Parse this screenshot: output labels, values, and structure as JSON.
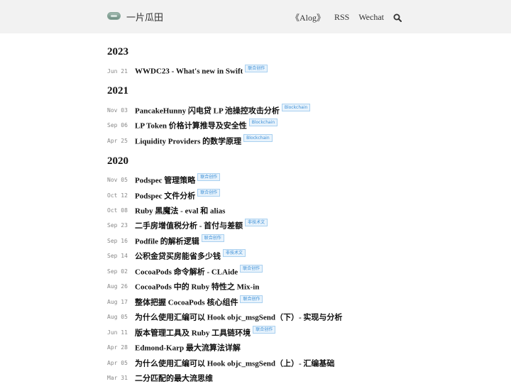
{
  "header": {
    "site_title": "一片瓜田",
    "nav": [
      "《Alog》",
      "RSS",
      "Wechat"
    ],
    "search_icon": "search-icon"
  },
  "archive": [
    {
      "year": "2023",
      "posts": [
        {
          "date": "Jun 21",
          "title": "WWDC23 - What's new in Swift",
          "tag": "联合创作"
        }
      ]
    },
    {
      "year": "2021",
      "posts": [
        {
          "date": "Nov 03",
          "title": "PancakeHunny 闪电贷 LP 池操控攻击分析",
          "tag": "Blockchain"
        },
        {
          "date": "Sep 06",
          "title": "LP Token 价格计算推导及安全性",
          "tag": "Blockchain"
        },
        {
          "date": "Apr 25",
          "title": "Liquidity Providers 的数学原理",
          "tag": "Blockchain"
        }
      ]
    },
    {
      "year": "2020",
      "posts": [
        {
          "date": "Nov 05",
          "title": "Podspec 管理策略",
          "tag": "联合创作"
        },
        {
          "date": "Oct 12",
          "title": "Podspec 文件分析",
          "tag": "联合创作"
        },
        {
          "date": "Oct 08",
          "title": "Ruby 黑魔法 - eval 和 alias",
          "tag": ""
        },
        {
          "date": "Sep 23",
          "title": "二手房增值税分析 - 首付与差额",
          "tag": "非技术文"
        },
        {
          "date": "Sep 16",
          "title": "Podfile 的解析逻辑",
          "tag": "联合创作"
        },
        {
          "date": "Sep 14",
          "title": "公积金贷买房能省多少钱",
          "tag": "非技术文"
        },
        {
          "date": "Sep 02",
          "title": "CocoaPods 命令解析 - CLAide",
          "tag": "联合创作"
        },
        {
          "date": "Aug 26",
          "title": "CocoaPods 中的 Ruby 特性之 Mix-in",
          "tag": ""
        },
        {
          "date": "Aug 17",
          "title": "整体把握 CocoaPods 核心组件",
          "tag": "联合创作"
        },
        {
          "date": "Aug 05",
          "title": "为什么使用汇编可以 Hook objc_msgSend（下）- 实现与分析",
          "tag": ""
        },
        {
          "date": "Jun 11",
          "title": "版本管理工具及 Ruby 工具链环境",
          "tag": "联合创作"
        },
        {
          "date": "Apr 28",
          "title": "Edmond-Karp 最大流算法详解",
          "tag": ""
        },
        {
          "date": "Apr 05",
          "title": "为什么使用汇编可以 Hook objc_msgSend（上）- 汇编基础",
          "tag": ""
        },
        {
          "date": "Mar 31",
          "title": "二分匹配的最大流思维",
          "tag": ""
        }
      ]
    }
  ]
}
